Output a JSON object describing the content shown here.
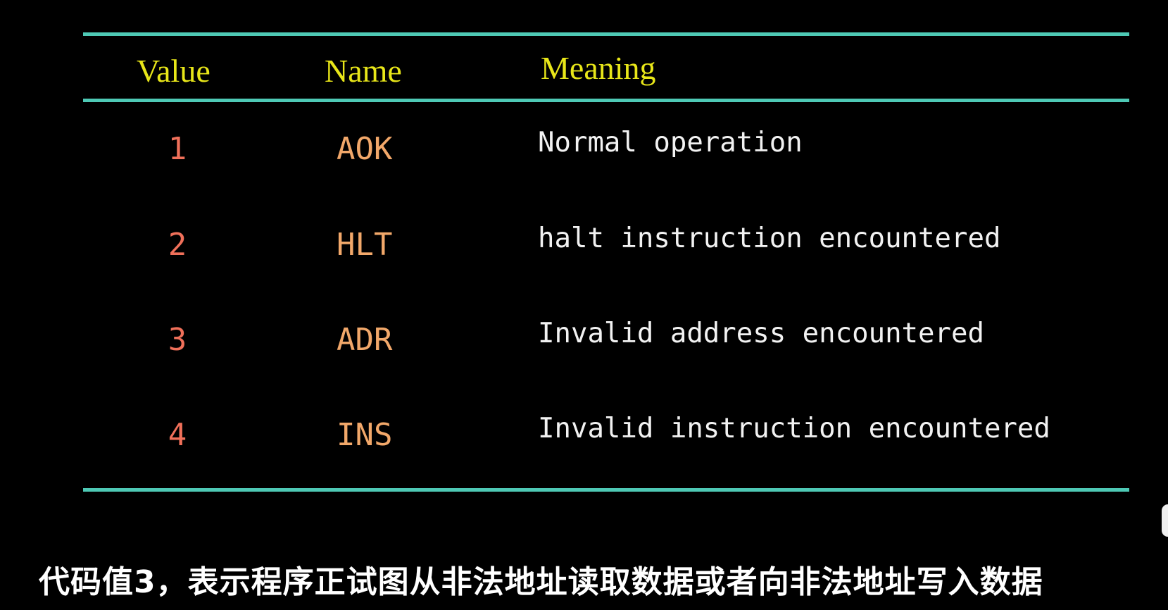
{
  "table": {
    "headers": {
      "value": "Value",
      "name": "Name",
      "meaning": "Meaning"
    },
    "rows": [
      {
        "value": "1",
        "name": "AOK",
        "meaning": "Normal operation"
      },
      {
        "value": "2",
        "name": "HLT",
        "meaning": "halt instruction encountered"
      },
      {
        "value": "3",
        "name": "ADR",
        "meaning": "Invalid address encountered"
      },
      {
        "value": "4",
        "name": "INS",
        "meaning": "Invalid instruction encountered"
      }
    ]
  },
  "subtitle": "代码值3，表示程序正试图从非法地址读取数据或者向非法地址写入数据",
  "colors": {
    "background": "#000000",
    "rule": "#4ec9b5",
    "header": "#e8e619",
    "value": "#f0705a",
    "name": "#f2a86a",
    "meaning": "#f2f2f2",
    "subtitle": "#ffffff"
  }
}
